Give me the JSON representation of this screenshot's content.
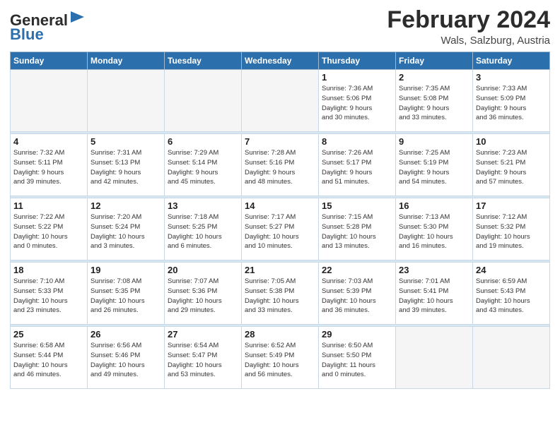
{
  "logo": {
    "line1": "General",
    "line2": "Blue"
  },
  "title": "February 2024",
  "subtitle": "Wals, Salzburg, Austria",
  "headers": [
    "Sunday",
    "Monday",
    "Tuesday",
    "Wednesday",
    "Thursday",
    "Friday",
    "Saturday"
  ],
  "weeks": [
    [
      {
        "day": "",
        "info": ""
      },
      {
        "day": "",
        "info": ""
      },
      {
        "day": "",
        "info": ""
      },
      {
        "day": "",
        "info": ""
      },
      {
        "day": "1",
        "info": "Sunrise: 7:36 AM\nSunset: 5:06 PM\nDaylight: 9 hours\nand 30 minutes."
      },
      {
        "day": "2",
        "info": "Sunrise: 7:35 AM\nSunset: 5:08 PM\nDaylight: 9 hours\nand 33 minutes."
      },
      {
        "day": "3",
        "info": "Sunrise: 7:33 AM\nSunset: 5:09 PM\nDaylight: 9 hours\nand 36 minutes."
      }
    ],
    [
      {
        "day": "4",
        "info": "Sunrise: 7:32 AM\nSunset: 5:11 PM\nDaylight: 9 hours\nand 39 minutes."
      },
      {
        "day": "5",
        "info": "Sunrise: 7:31 AM\nSunset: 5:13 PM\nDaylight: 9 hours\nand 42 minutes."
      },
      {
        "day": "6",
        "info": "Sunrise: 7:29 AM\nSunset: 5:14 PM\nDaylight: 9 hours\nand 45 minutes."
      },
      {
        "day": "7",
        "info": "Sunrise: 7:28 AM\nSunset: 5:16 PM\nDaylight: 9 hours\nand 48 minutes."
      },
      {
        "day": "8",
        "info": "Sunrise: 7:26 AM\nSunset: 5:17 PM\nDaylight: 9 hours\nand 51 minutes."
      },
      {
        "day": "9",
        "info": "Sunrise: 7:25 AM\nSunset: 5:19 PM\nDaylight: 9 hours\nand 54 minutes."
      },
      {
        "day": "10",
        "info": "Sunrise: 7:23 AM\nSunset: 5:21 PM\nDaylight: 9 hours\nand 57 minutes."
      }
    ],
    [
      {
        "day": "11",
        "info": "Sunrise: 7:22 AM\nSunset: 5:22 PM\nDaylight: 10 hours\nand 0 minutes."
      },
      {
        "day": "12",
        "info": "Sunrise: 7:20 AM\nSunset: 5:24 PM\nDaylight: 10 hours\nand 3 minutes."
      },
      {
        "day": "13",
        "info": "Sunrise: 7:18 AM\nSunset: 5:25 PM\nDaylight: 10 hours\nand 6 minutes."
      },
      {
        "day": "14",
        "info": "Sunrise: 7:17 AM\nSunset: 5:27 PM\nDaylight: 10 hours\nand 10 minutes."
      },
      {
        "day": "15",
        "info": "Sunrise: 7:15 AM\nSunset: 5:28 PM\nDaylight: 10 hours\nand 13 minutes."
      },
      {
        "day": "16",
        "info": "Sunrise: 7:13 AM\nSunset: 5:30 PM\nDaylight: 10 hours\nand 16 minutes."
      },
      {
        "day": "17",
        "info": "Sunrise: 7:12 AM\nSunset: 5:32 PM\nDaylight: 10 hours\nand 19 minutes."
      }
    ],
    [
      {
        "day": "18",
        "info": "Sunrise: 7:10 AM\nSunset: 5:33 PM\nDaylight: 10 hours\nand 23 minutes."
      },
      {
        "day": "19",
        "info": "Sunrise: 7:08 AM\nSunset: 5:35 PM\nDaylight: 10 hours\nand 26 minutes."
      },
      {
        "day": "20",
        "info": "Sunrise: 7:07 AM\nSunset: 5:36 PM\nDaylight: 10 hours\nand 29 minutes."
      },
      {
        "day": "21",
        "info": "Sunrise: 7:05 AM\nSunset: 5:38 PM\nDaylight: 10 hours\nand 33 minutes."
      },
      {
        "day": "22",
        "info": "Sunrise: 7:03 AM\nSunset: 5:39 PM\nDaylight: 10 hours\nand 36 minutes."
      },
      {
        "day": "23",
        "info": "Sunrise: 7:01 AM\nSunset: 5:41 PM\nDaylight: 10 hours\nand 39 minutes."
      },
      {
        "day": "24",
        "info": "Sunrise: 6:59 AM\nSunset: 5:43 PM\nDaylight: 10 hours\nand 43 minutes."
      }
    ],
    [
      {
        "day": "25",
        "info": "Sunrise: 6:58 AM\nSunset: 5:44 PM\nDaylight: 10 hours\nand 46 minutes."
      },
      {
        "day": "26",
        "info": "Sunrise: 6:56 AM\nSunset: 5:46 PM\nDaylight: 10 hours\nand 49 minutes."
      },
      {
        "day": "27",
        "info": "Sunrise: 6:54 AM\nSunset: 5:47 PM\nDaylight: 10 hours\nand 53 minutes."
      },
      {
        "day": "28",
        "info": "Sunrise: 6:52 AM\nSunset: 5:49 PM\nDaylight: 10 hours\nand 56 minutes."
      },
      {
        "day": "29",
        "info": "Sunrise: 6:50 AM\nSunset: 5:50 PM\nDaylight: 11 hours\nand 0 minutes."
      },
      {
        "day": "",
        "info": ""
      },
      {
        "day": "",
        "info": ""
      }
    ]
  ]
}
